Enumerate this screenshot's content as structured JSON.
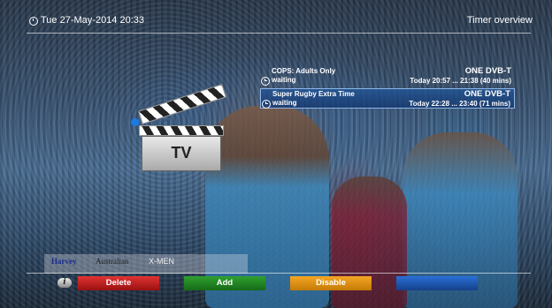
{
  "header": {
    "datetime": "Tue 27-May-2014 20:33",
    "title": "Timer overview"
  },
  "timers": [
    {
      "name": "COPS: Adults Only",
      "service": "ONE  DVB-T",
      "state": "waiting",
      "time": "Today 20:57 ... 21:38 (40 mins)",
      "selected": false
    },
    {
      "name": "Super Rugby Extra Time",
      "service": "ONE  DVB-T",
      "state": "waiting",
      "time": "Today 22:28 ... 23:40 (71 mins)",
      "selected": true
    }
  ],
  "logo": {
    "text": "TV",
    "icon": "clapperboard-icon",
    "accent": "#1a7be6"
  },
  "footer": {
    "info_icon": "i",
    "red_label": "Delete",
    "green_label": "Add",
    "yellow_label": "Disable",
    "blue_label": ""
  },
  "sponsors": {
    "s1": "Harvey",
    "s2": "Australian",
    "s3": "X-MEN"
  },
  "colors": {
    "red": "#c91f1f",
    "green": "#228822",
    "yellow": "#e8961a",
    "blue": "#1f56b8",
    "selection": "#22559a"
  }
}
